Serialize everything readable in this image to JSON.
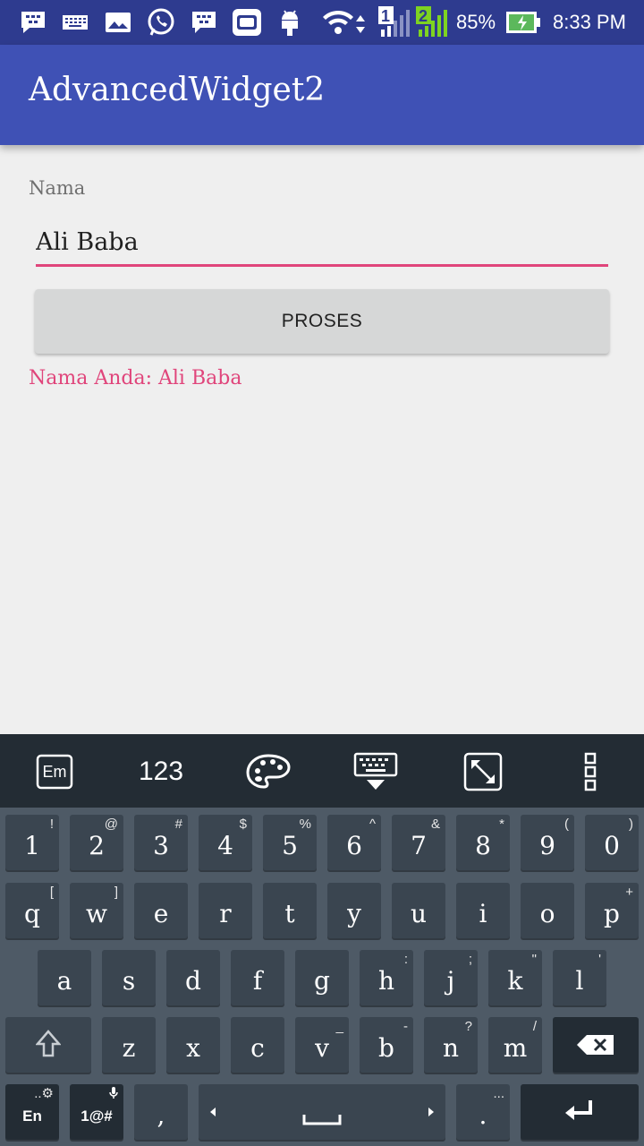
{
  "status_bar": {
    "icons": [
      "bbm-icon",
      "keyboard-icon",
      "gallery-icon",
      "whatsapp-icon",
      "bbm-icon",
      "app-icon",
      "android-icon",
      "wifi-icon",
      "sim1-signal-icon",
      "sim2-signal-icon",
      "battery-charging-icon"
    ],
    "sim1": "1",
    "sim2": "2",
    "battery": "85%",
    "time": "8:33 PM"
  },
  "app_bar": {
    "title": "AdvancedWidget2"
  },
  "form": {
    "label": "Nama",
    "input_value": "Ali Baba",
    "button_label": "PROSES",
    "result": "Nama Anda: Ali Baba"
  },
  "keyboard": {
    "toolbar": {
      "language": "Em",
      "numbers": "123",
      "icons": [
        "language-icon",
        "theme-palette-icon",
        "hide-keyboard-icon",
        "resize-icon",
        "more-icon"
      ]
    },
    "row1": [
      {
        "main": "1",
        "sub": "!"
      },
      {
        "main": "2",
        "sub": "@"
      },
      {
        "main": "3",
        "sub": "#"
      },
      {
        "main": "4",
        "sub": "$"
      },
      {
        "main": "5",
        "sub": "%"
      },
      {
        "main": "6",
        "sub": "^"
      },
      {
        "main": "7",
        "sub": "&"
      },
      {
        "main": "8",
        "sub": "*"
      },
      {
        "main": "9",
        "sub": "("
      },
      {
        "main": "0",
        "sub": ")"
      }
    ],
    "row2": [
      {
        "main": "q",
        "sub": "["
      },
      {
        "main": "w",
        "sub": "]"
      },
      {
        "main": "e",
        "sub": ""
      },
      {
        "main": "r",
        "sub": ""
      },
      {
        "main": "t",
        "sub": ""
      },
      {
        "main": "y",
        "sub": ""
      },
      {
        "main": "u",
        "sub": ""
      },
      {
        "main": "i",
        "sub": ""
      },
      {
        "main": "o",
        "sub": ""
      },
      {
        "main": "p",
        "sub": "+"
      }
    ],
    "row3": [
      {
        "main": "a",
        "sub": ""
      },
      {
        "main": "s",
        "sub": ""
      },
      {
        "main": "d",
        "sub": ""
      },
      {
        "main": "f",
        "sub": ""
      },
      {
        "main": "g",
        "sub": ""
      },
      {
        "main": "h",
        "sub": ":"
      },
      {
        "main": "j",
        "sub": ";"
      },
      {
        "main": "k",
        "sub": "\""
      },
      {
        "main": "l",
        "sub": "'"
      }
    ],
    "row4": [
      {
        "main": "z",
        "sub": ""
      },
      {
        "main": "x",
        "sub": ""
      },
      {
        "main": "c",
        "sub": ""
      },
      {
        "main": "v",
        "sub": "_"
      },
      {
        "main": "b",
        "sub": "-"
      },
      {
        "main": "n",
        "sub": "?"
      },
      {
        "main": "m",
        "sub": "/"
      }
    ],
    "row5": {
      "lang_key": "En",
      "lang_sub": "..⚙",
      "symbols_key": "1@#",
      "comma": ",",
      "period": ".",
      "period_sub": "..."
    }
  }
}
